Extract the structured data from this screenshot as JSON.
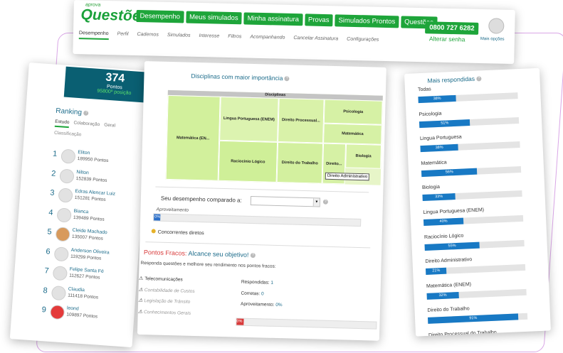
{
  "header": {
    "logo_top": "aprova",
    "logo_main": "Questões",
    "nav": [
      "Desempenho",
      "Meus simulados",
      "Minha assinatura",
      "Provas",
      "Simulados Prontos",
      "Questões"
    ],
    "phone": "0800 727 6282",
    "alterar_senha": "Alterar senha",
    "mais_opcoes": "Mais opções",
    "subnav": [
      "Desempenho",
      "Perfil",
      "Cadernos",
      "Simulados",
      "Interesse",
      "Filtros",
      "Acompanhando",
      "Cancelar Assinatura",
      "Configurações"
    ]
  },
  "score": {
    "value": "374",
    "label": "Pontos",
    "position": "95800º posição"
  },
  "ranking": {
    "title": "Ranking",
    "tabs": [
      "Estudo",
      "Colaboração",
      "Geral"
    ],
    "classificacao": "Classificação",
    "items": [
      {
        "rank": "1",
        "name": "Eliton",
        "points": "189950 Pontos"
      },
      {
        "rank": "2",
        "name": "Nilton",
        "points": "152839 Pontos"
      },
      {
        "rank": "3",
        "name": "Edras Alencar Luiz",
        "points": "151281 Pontos"
      },
      {
        "rank": "4",
        "name": "Bianca",
        "points": "139489 Pontos"
      },
      {
        "rank": "5",
        "name": "Cleide Machado",
        "points": "135007 Pontos"
      },
      {
        "rank": "6",
        "name": "Anderson Oliveira",
        "points": "119299 Pontos"
      },
      {
        "rank": "7",
        "name": "Felipe Santa Fé",
        "points": "112627 Pontos"
      },
      {
        "rank": "8",
        "name": "Claudia",
        "points": "111418 Pontos"
      },
      {
        "rank": "9",
        "name": "leond",
        "points": "109897 Pontos"
      }
    ]
  },
  "disciplinas": {
    "title": "Disciplinas com maior importância",
    "header": "Disciplinas",
    "cells": [
      "Matemática (EN...",
      "Lingua Portuguesa (ENEM)",
      "Direito Processual...",
      "Psicologia",
      "Matemática",
      "Raciocínio Lógico",
      "Direito do Trabalho",
      "Direito...",
      "Biologia"
    ],
    "tooltip": "Direito Administrativo"
  },
  "comparacao": {
    "label": "Seu desempenho comparado a:",
    "aproveitamento_label": "Aproveitamento",
    "value": "0%",
    "concorrentes": "Concorrentes diretos"
  },
  "pontos_fracos": {
    "title_red": "Pontos Fracos:",
    "title_blue": "Alcance seu objetivo!",
    "subtitle": "Responda questões e melhore seu rendimento nos pontos fracos:",
    "items": [
      "Telecomunicações",
      "Contabilidade de Custos",
      "Legislação de Trânsito",
      "Conhecimentos Gerais"
    ],
    "respondidas_label": "Respondidas:",
    "respondidas_value": "1",
    "corretas_label": "Corretas:",
    "corretas_value": "0",
    "aproveitamento_label": "Aproveitamento:",
    "aproveitamento_value": "0%",
    "bar_value": "0%"
  },
  "mais_respondidas": {
    "title": "Mais respondidas",
    "items": [
      {
        "label": "Todas",
        "value": "38%",
        "pct": 38
      },
      {
        "label": "Psicologia",
        "value": "51%",
        "pct": 51
      },
      {
        "label": "Lingua Portuguesa",
        "value": "38%",
        "pct": 38
      },
      {
        "label": "Matemática",
        "value": "56%",
        "pct": 56
      },
      {
        "label": "Biologia",
        "value": "33%",
        "pct": 33
      },
      {
        "label": "Lingua Portuguesa (ENEM)",
        "value": "40%",
        "pct": 40
      },
      {
        "label": "Raciocínio Lógico",
        "value": "55%",
        "pct": 55
      },
      {
        "label": "Direito Administrativo",
        "value": "21%",
        "pct": 21
      },
      {
        "label": "Matemática (ENEM)",
        "value": "32%",
        "pct": 32
      },
      {
        "label": "Direito do Trabalho",
        "value": "91%",
        "pct": 91
      },
      {
        "label": "Direito Processual do Trabalho",
        "value": "",
        "pct": 0
      }
    ]
  }
}
